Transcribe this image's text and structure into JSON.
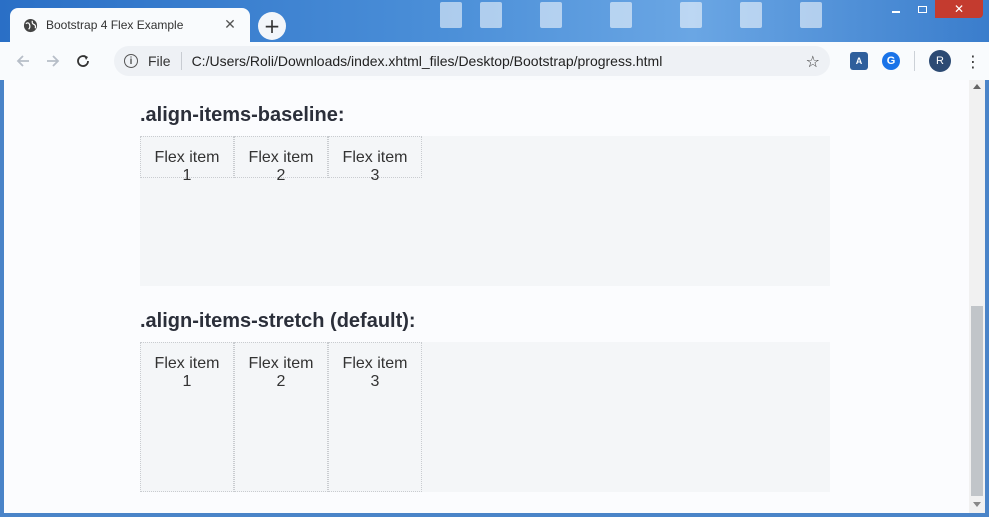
{
  "browser": {
    "tab_title": "Bootstrap 4 Flex Example",
    "tab_icon": "globe-icon",
    "new_tab_label": "+",
    "address": {
      "scheme_label": "File",
      "url": "C:/Users/Roli/Downloads/index.xhtml_files/Desktop/Bootstrap/progress.html"
    },
    "extensions": [
      {
        "name": "extension-a-icon",
        "label": "A"
      },
      {
        "name": "grammarly-icon",
        "label": "G"
      }
    ],
    "profile_initial": "R"
  },
  "page": {
    "sections": [
      {
        "heading": ".align-items-baseline:",
        "items": [
          "Flex item 1",
          "Flex item 2",
          "Flex item 3"
        ]
      },
      {
        "heading": ".align-items-stretch (default):",
        "items": [
          "Flex item 1",
          "Flex item 2",
          "Flex item 3"
        ]
      }
    ]
  },
  "colors": {
    "heading": "#2b2f3a",
    "flex_bg": "#f4f6f8",
    "item_border": "#c9ccd0",
    "close_button": "#c43b2f"
  }
}
